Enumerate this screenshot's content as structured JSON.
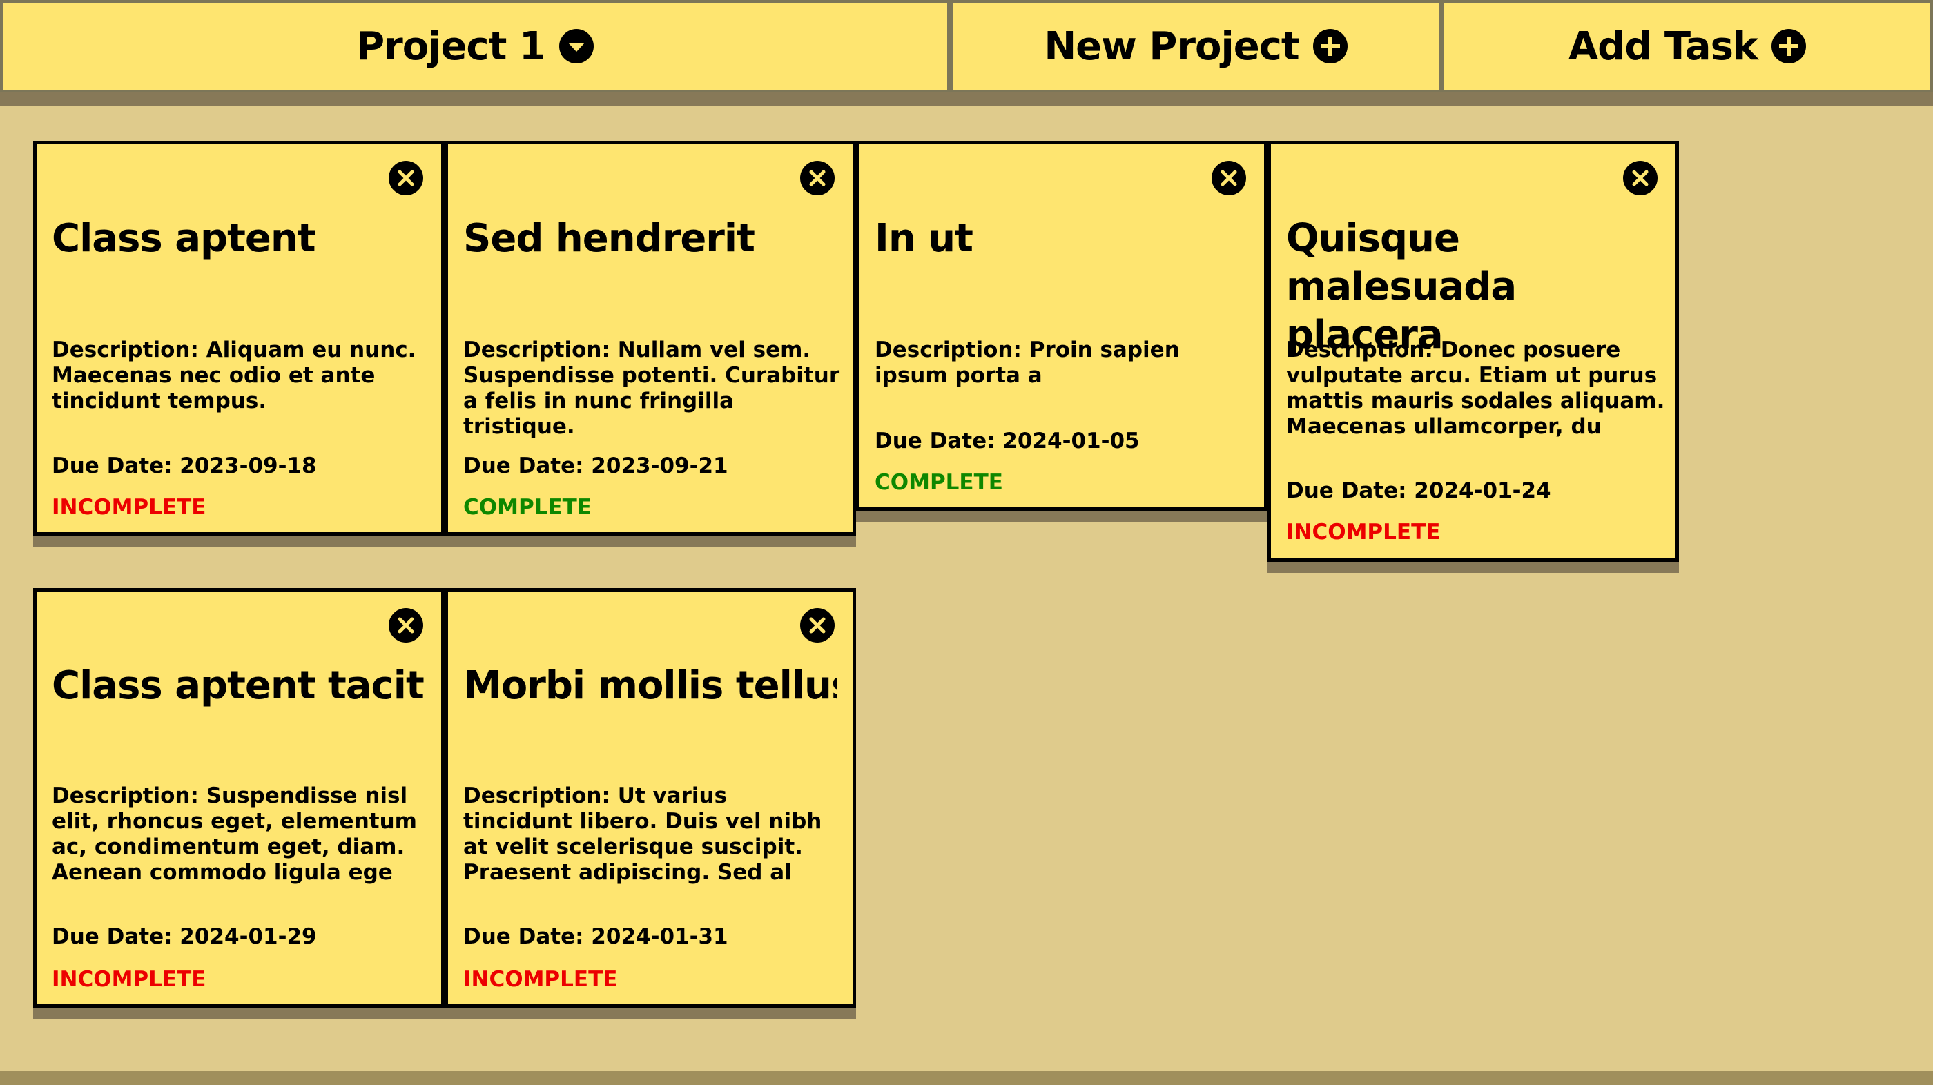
{
  "header": {
    "project_label": "Project 1",
    "new_project_label": "New Project",
    "add_task_label": "Add Task"
  },
  "colors": {
    "card_bg": "#fee570",
    "page_bg": "#dfcb8c",
    "incomplete": "#ec0000",
    "complete": "#0e8700"
  },
  "tasks": [
    {
      "title": "Class aptent",
      "description": "Description: Aliquam eu nunc. Maecenas nec odio et ante tincidunt tempus.",
      "due": "Due Date: 2023-09-18",
      "status": "INCOMPLETE"
    },
    {
      "title": "Sed hendrerit",
      "description": "Description: Nullam vel sem. Suspendisse potenti. Curabitur a felis in nunc fringilla tristique.",
      "due": "Due Date: 2023-09-21",
      "status": "COMPLETE"
    },
    {
      "title": "In ut",
      "description": "Description: Proin sapien ipsum porta a",
      "due": "Due Date: 2024-01-05",
      "status": "COMPLETE"
    },
    {
      "title": "Quisque malesuada placera",
      "description": "Description: Donec posuere vulputate arcu. Etiam ut purus mattis mauris sodales aliquam. Maecenas ullamcorper, du",
      "due": "Due Date: 2024-01-24",
      "status": "INCOMPLETE"
    },
    {
      "title": "Class aptent taciti",
      "description": "Description: Suspendisse nisl elit, rhoncus eget, elementum ac, condimentum eget, diam. Aenean commodo ligula ege",
      "due": "Due Date: 2024-01-29",
      "status": "INCOMPLETE"
    },
    {
      "title": "Morbi mollis tellus",
      "description": "Description: Ut varius tincidunt libero. Duis vel nibh at velit scelerisque suscipit. Praesent adipiscing. Sed al",
      "due": "Due Date: 2024-01-31",
      "status": "INCOMPLETE"
    }
  ]
}
